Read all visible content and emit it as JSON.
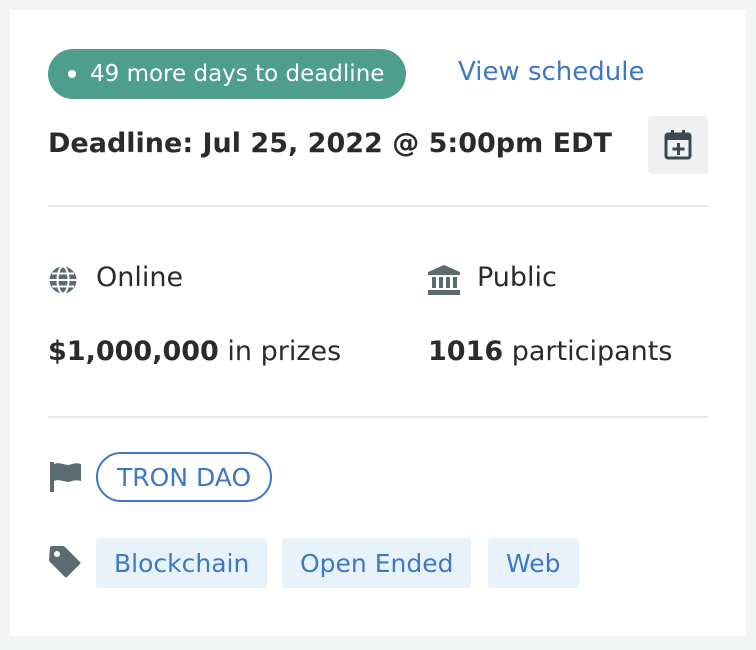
{
  "status": {
    "days_left_label": "49 more days to deadline"
  },
  "schedule_link": "View schedule",
  "deadline": "Deadline: Jul 25, 2022 @ 5:00pm EDT",
  "location": {
    "label": "Online",
    "icon": "globe-icon"
  },
  "visibility": {
    "label": "Public",
    "icon": "institution-icon"
  },
  "prizes": {
    "amount": "$1,000,000",
    "suffix": " in prizes"
  },
  "participants": {
    "count": "1016",
    "suffix": " participants"
  },
  "host": {
    "name": "TRON DAO",
    "icon": "flag-icon"
  },
  "themes": {
    "icon": "tag-icon",
    "items": [
      "Blockchain",
      "Open Ended",
      "Web"
    ]
  },
  "colors": {
    "accent": "#4e9e8e",
    "link": "#3d78c5",
    "tag_bg": "#e8f2fb"
  }
}
